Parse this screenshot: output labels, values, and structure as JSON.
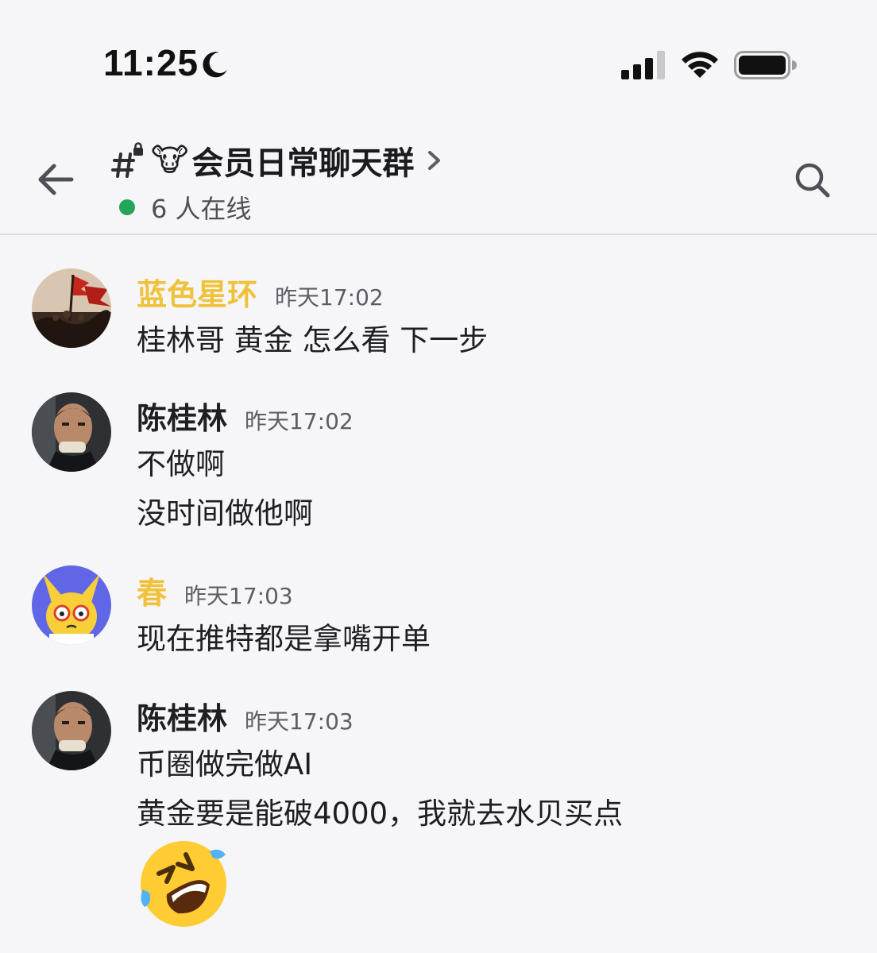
{
  "status_bar": {
    "time": "11:25",
    "icons": [
      "moon-icon",
      "cellular-signal-icon",
      "wifi-icon",
      "battery-icon"
    ]
  },
  "header": {
    "channel_icon": "hashtag-lock-icon",
    "channel_emoji": "🐮",
    "channel_name": "会员日常聊天群",
    "online_status": "6 人在线",
    "online_color": "#23a55a",
    "icons": [
      "back-arrow-icon",
      "chevron-right-icon",
      "search-icon"
    ]
  },
  "messages": [
    {
      "username": "蓝色星环",
      "username_color": "#f0c23b",
      "timestamp": "昨天17:02",
      "lines": [
        "桂林哥  黄金  怎么看 下一步"
      ]
    },
    {
      "username": "陈桂林",
      "username_color": "#1e1f22",
      "timestamp": "昨天17:02",
      "lines": [
        "不做啊",
        "没时间做他啊"
      ]
    },
    {
      "username": "春",
      "username_color": "#f0c23b",
      "timestamp": "昨天17:03",
      "lines": [
        "现在推特都是拿嘴开单"
      ]
    },
    {
      "username": "陈桂林",
      "username_color": "#1e1f22",
      "timestamp": "昨天17:03",
      "lines": [
        "币圈做完做AI",
        "黄金要是能破4000，我就去水贝买点"
      ],
      "emoji": "rolling-on-floor-laughing-emoji"
    }
  ],
  "colors": {
    "background": "#f6f6f8",
    "divider": "#dcdce4",
    "timestamp": "#5c5e66"
  }
}
